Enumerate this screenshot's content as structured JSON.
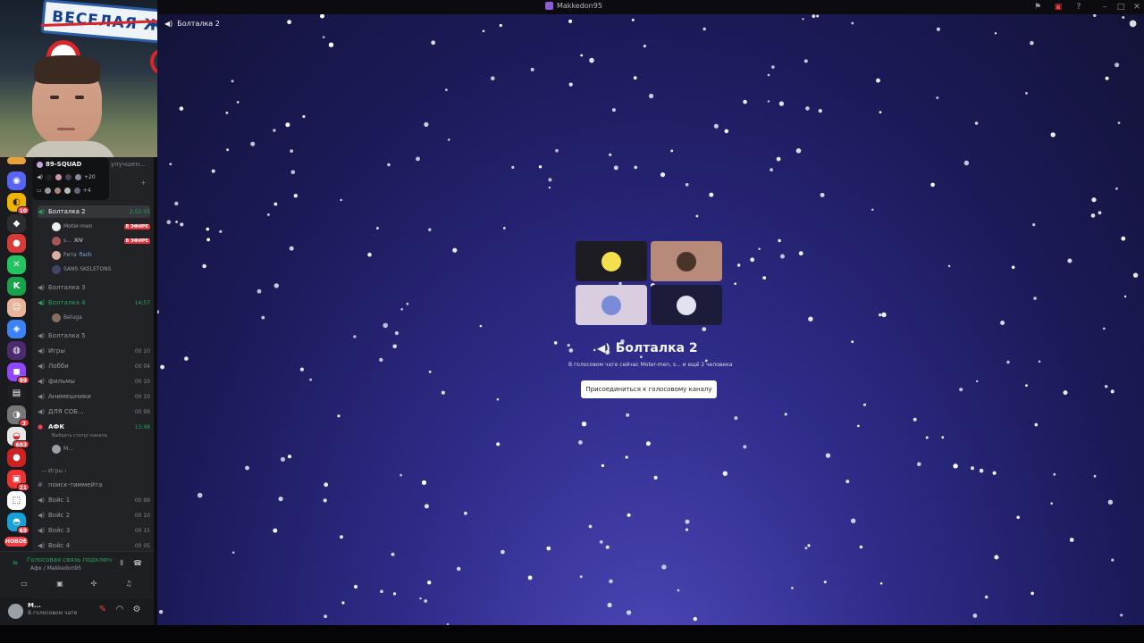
{
  "window": {
    "title": "Makkedon95"
  },
  "webcam": {
    "sign_text": "ВЕСЕЛАЯ ЖИЗ"
  },
  "server_rail": {
    "badges": [
      "10",
      "99",
      "3",
      "603",
      "21",
      "69"
    ],
    "new_label": "НОВОЕ"
  },
  "guild_popup": {
    "name": "89-SQUAD",
    "row1_count": "+20",
    "row2_count": "+4",
    "behind_text": "улучшен..."
  },
  "channels": {
    "boltalka2": {
      "name": "Болталка 2",
      "time": "2:52:55"
    },
    "users_b2": [
      {
        "name": "Moter-men",
        "live": "В ЭФИРЕ"
      },
      {
        "name": "s...",
        "extra": "XIV",
        "live": "В ЭФИРЕ"
      },
      {
        "name": "Рита",
        "extra": "fisch"
      },
      {
        "name": "SANS SKELETONS"
      }
    ],
    "boltalka3": {
      "name": "Болталка 3"
    },
    "boltalka4": {
      "name": "Болталка 4",
      "time": "14:57"
    },
    "user_b4": {
      "name": "Beluga"
    },
    "boltalka5": {
      "name": "Болталка 5"
    },
    "igry": {
      "name": "Игры",
      "count": "00 10"
    },
    "lobbi": {
      "name": "Лобби",
      "count": "00 04"
    },
    "filmy": {
      "name": "фильмы",
      "count": "00 10"
    },
    "animeshniki": {
      "name": "Анимешники",
      "count": "00 10"
    },
    "dlya_sob": {
      "name": "ДЛЯ СОБ...",
      "count": "00 99"
    },
    "afk": {
      "name": "АФК",
      "time": "13:48",
      "status": "Выбрать статус канала"
    },
    "user_afk": {
      "name": "M..."
    },
    "category_games": "Игры",
    "search_team": "поиск-тиммейта",
    "voice1": {
      "name": "Войс 1",
      "count": "00 99"
    },
    "voice2": {
      "name": "Войс 2",
      "count": "00 10"
    },
    "voice3": {
      "name": "Войс 3",
      "count": "00 15"
    },
    "voice4": {
      "name": "Войс 4",
      "count": "00 05"
    }
  },
  "voice_status": {
    "status": "Голосовая связь подключена",
    "location": "Афк / Makkedon95"
  },
  "user_panel": {
    "name": "M...",
    "sub": "В голосовом чате"
  },
  "main": {
    "header_channel": "Болталка 2",
    "channel_title": "Болталка 2",
    "subtitle": "В голосовом чате сейчас Moter-men, s... и ещё 2 человека",
    "join_button": "Присоединиться к голосовому каналу"
  },
  "colors": {
    "accent_green": "#23a55a",
    "live_red": "#e8343a",
    "background_blue": "#2f2c8a"
  }
}
